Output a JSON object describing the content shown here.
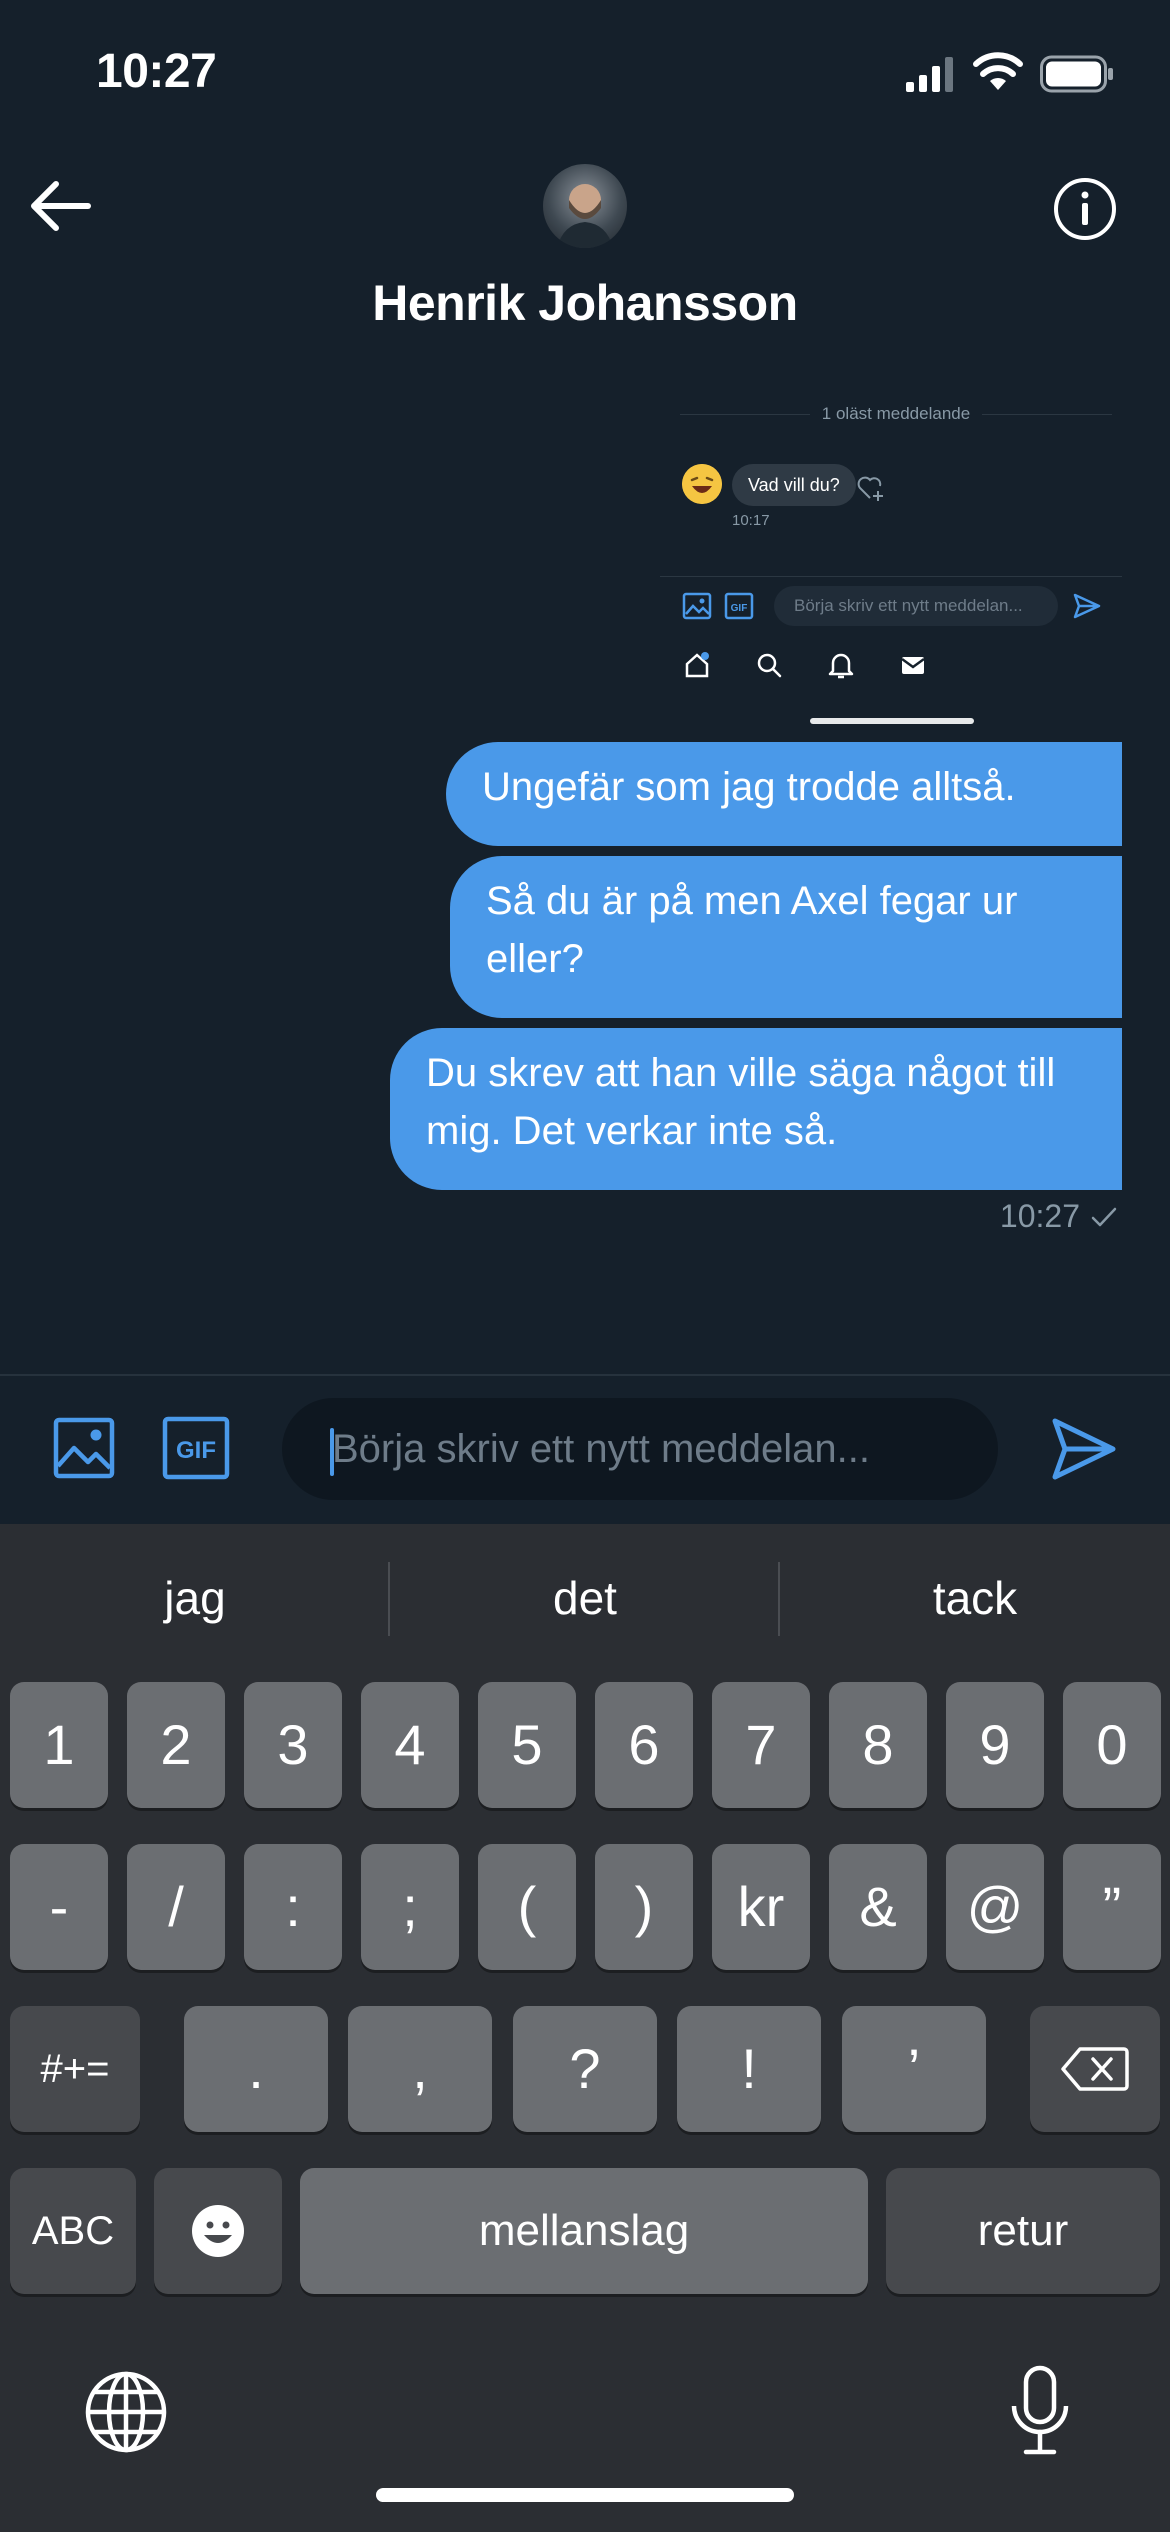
{
  "status_bar": {
    "time": "10:27"
  },
  "header": {
    "contact_name": "Henrik Johansson"
  },
  "shared_screenshot": {
    "unread_label": "1 oläst meddelande",
    "message": "Vad vill du?",
    "message_time": "10:17",
    "input_placeholder": "Börja skriv ett nytt meddelan..."
  },
  "messages": [
    {
      "text": "Ungefär som jag trodde alltså."
    },
    {
      "text": "Så du är på men Axel fegar ur eller?"
    },
    {
      "text": "Du skrev att han ville säga något till mig. Det verkar inte så."
    }
  ],
  "last_message_time": "10:27",
  "composer": {
    "placeholder": "Börja skriv ett nytt meddelan...",
    "gif_label": "GIF"
  },
  "keyboard": {
    "suggestions": [
      "jag",
      "det",
      "tack"
    ],
    "row1": [
      "1",
      "2",
      "3",
      "4",
      "5",
      "6",
      "7",
      "8",
      "9",
      "0"
    ],
    "row2": [
      "-",
      "/",
      ":",
      ";",
      "(",
      ")",
      "kr",
      "&",
      "@",
      "”"
    ],
    "row3_toggle": "#+=",
    "row3": [
      ".",
      ",",
      "?",
      "!",
      "’"
    ],
    "abc_label": "ABC",
    "space_label": "mellanslag",
    "return_label": "retur"
  },
  "colors": {
    "background": "#15202b",
    "accent": "#4a99e9",
    "secondary_text": "#8899a6",
    "keyboard_bg": "#2b2e33"
  }
}
